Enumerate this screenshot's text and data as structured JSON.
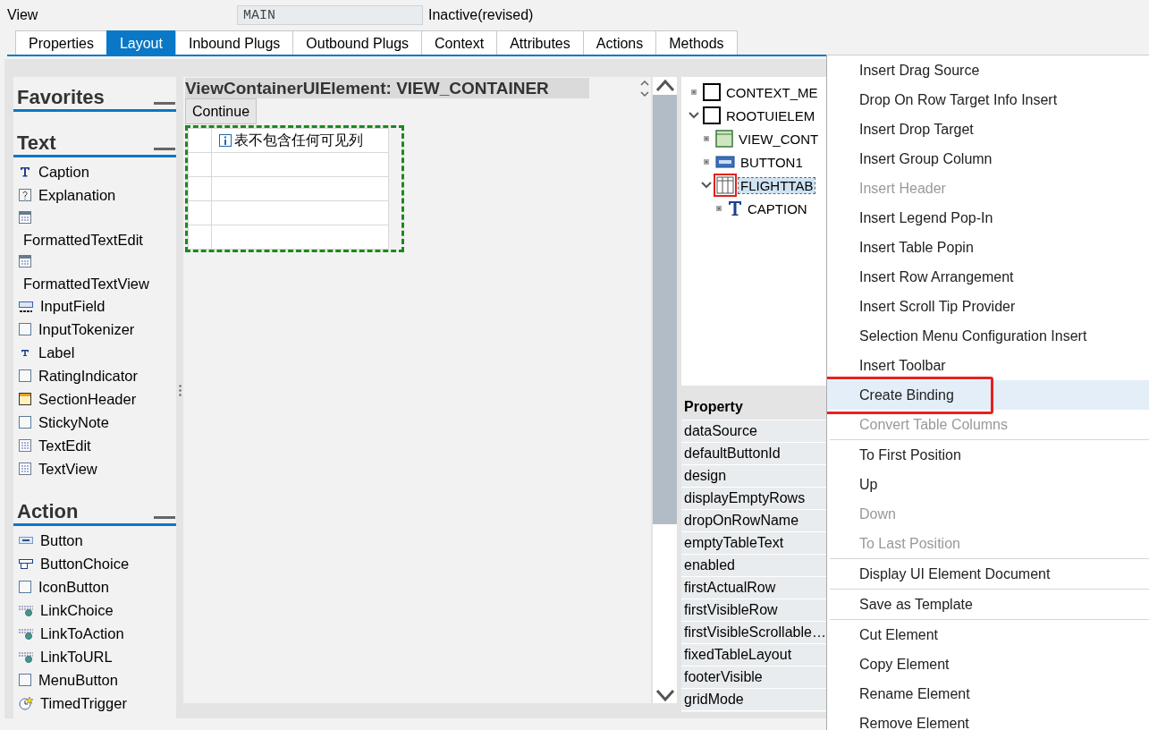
{
  "header": {
    "label": "View",
    "name": "MAIN",
    "status": "Inactive(revised)"
  },
  "tabs": [
    {
      "label": "Properties",
      "selected": false
    },
    {
      "label": "Layout",
      "selected": true
    },
    {
      "label": "Inbound Plugs",
      "selected": false
    },
    {
      "label": "Outbound Plugs",
      "selected": false
    },
    {
      "label": "Context",
      "selected": false
    },
    {
      "label": "Attributes",
      "selected": false
    },
    {
      "label": "Actions",
      "selected": false
    },
    {
      "label": "Methods",
      "selected": false
    }
  ],
  "palette": [
    {
      "title": "Favorites"
    },
    {
      "title": "Text",
      "items": [
        {
          "label": "Caption",
          "kind": "caption"
        },
        {
          "label": "Explanation",
          "kind": "explanation"
        },
        {
          "label": "FormattedTextEdit",
          "kind": "formatted"
        },
        {
          "label": "FormattedTextView",
          "kind": "formatted"
        },
        {
          "label": "InputField",
          "kind": "input"
        },
        {
          "label": "InputTokenizer",
          "kind": "plain"
        },
        {
          "label": "Label",
          "kind": "label"
        },
        {
          "label": "RatingIndicator",
          "kind": "plain"
        },
        {
          "label": "SectionHeader",
          "kind": "section"
        },
        {
          "label": "StickyNote",
          "kind": "plain"
        },
        {
          "label": "TextEdit",
          "kind": "textgrid"
        },
        {
          "label": "TextView",
          "kind": "textgrid"
        }
      ]
    },
    {
      "title": "Action",
      "items": [
        {
          "label": "Button",
          "kind": "button"
        },
        {
          "label": "ButtonChoice",
          "kind": "buttonchoice"
        },
        {
          "label": "IconButton",
          "kind": "plain"
        },
        {
          "label": "LinkChoice",
          "kind": "link"
        },
        {
          "label": "LinkToAction",
          "kind": "link"
        },
        {
          "label": "LinkToURL",
          "kind": "link"
        },
        {
          "label": "MenuButton",
          "kind": "plain"
        },
        {
          "label": "TimedTrigger",
          "kind": "timer"
        }
      ]
    }
  ],
  "canvas": {
    "title": "ViewContainerUIElement: VIEW_CONTAINER",
    "button": "Continue",
    "empty_text": "表不包含任何可见列"
  },
  "tree": [
    {
      "label": "CONTEXT_ME",
      "kind": "plain",
      "expanded": false,
      "selected": false
    },
    {
      "label": "ROOTUIELEM",
      "kind": "plain",
      "expanded": true,
      "selected": false,
      "children": [
        {
          "label": "VIEW_CONT",
          "kind": "container",
          "expanded": false,
          "selected": false
        },
        {
          "label": "BUTTON1",
          "kind": "button",
          "expanded": false,
          "selected": false
        },
        {
          "label": "FLIGHTTAB",
          "kind": "table",
          "expanded": true,
          "selected": true,
          "children": [
            {
              "label": "CAPTION",
              "kind": "caption",
              "expanded": false,
              "selected": false
            }
          ]
        }
      ]
    }
  ],
  "properties": {
    "heading": "Property",
    "rows": [
      "dataSource",
      "defaultButtonId",
      "design",
      "displayEmptyRows",
      "dropOnRowName",
      "emptyTableText",
      "enabled",
      "firstActualRow",
      "firstVisibleRow",
      "firstVisibleScrollable…",
      "fixedTableLayout",
      "footerVisible",
      "gridMode"
    ]
  },
  "menu": [
    [
      {
        "label": "Insert Drag Source",
        "disabled": false,
        "highlighted": false
      },
      {
        "label": "Drop On Row Target Info Insert",
        "disabled": false,
        "highlighted": false
      },
      {
        "label": "Insert Drop Target",
        "disabled": false,
        "highlighted": false
      },
      {
        "label": "Insert Group Column",
        "disabled": false,
        "highlighted": false
      },
      {
        "label": "Insert Header",
        "disabled": true,
        "highlighted": false
      },
      {
        "label": "Insert Legend Pop-In",
        "disabled": false,
        "highlighted": false
      },
      {
        "label": "Insert Table Popin",
        "disabled": false,
        "highlighted": false
      },
      {
        "label": "Insert Row Arrangement",
        "disabled": false,
        "highlighted": false
      },
      {
        "label": "Insert Scroll Tip Provider",
        "disabled": false,
        "highlighted": false
      },
      {
        "label": "Selection Menu Configuration Insert",
        "disabled": false,
        "highlighted": false
      },
      {
        "label": "Insert Toolbar",
        "disabled": false,
        "highlighted": false
      },
      {
        "label": "Create Binding",
        "disabled": false,
        "highlighted": true
      },
      {
        "label": "Convert Table Columns",
        "disabled": true,
        "highlighted": false
      }
    ],
    [
      {
        "label": "To First Position",
        "disabled": false,
        "highlighted": false
      },
      {
        "label": "Up",
        "disabled": false,
        "highlighted": false
      },
      {
        "label": "Down",
        "disabled": true,
        "highlighted": false
      },
      {
        "label": "To Last Position",
        "disabled": true,
        "highlighted": false
      }
    ],
    [
      {
        "label": "Display UI Element Document",
        "disabled": false,
        "highlighted": false
      }
    ],
    [
      {
        "label": "Save as Template",
        "disabled": false,
        "highlighted": false
      }
    ],
    [
      {
        "label": "Cut Element",
        "disabled": false,
        "highlighted": false
      },
      {
        "label": "Copy Element",
        "disabled": false,
        "highlighted": false
      },
      {
        "label": "Rename Element",
        "disabled": false,
        "highlighted": false
      },
      {
        "label": "Remove Element",
        "disabled": false,
        "highlighted": false
      }
    ]
  ]
}
